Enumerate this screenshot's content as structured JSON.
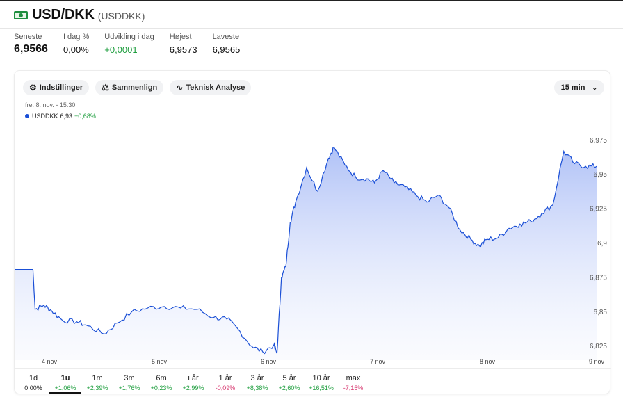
{
  "header": {
    "title": "USD/DKK",
    "subtitle": "(USDDKK)"
  },
  "stats": [
    {
      "label": "Seneste",
      "value": "6,9566"
    },
    {
      "label": "I dag %",
      "value": "0,00%"
    },
    {
      "label": "Udvikling i dag",
      "value": "+0,0001"
    },
    {
      "label": "Højest",
      "value": "6,9573"
    },
    {
      "label": "Laveste",
      "value": "6,9565"
    }
  ],
  "toolbar": {
    "settings": "Indstillinger",
    "compare": "Sammenlign",
    "technical": "Teknisk Analyse",
    "interval": "15 min"
  },
  "datetime": "fre. 8. nov. - 15.30",
  "legend": {
    "name": "USDDKK",
    "value": "6,93",
    "change": "+0,68%"
  },
  "ranges": [
    {
      "label": "1d",
      "change": "0,00%",
      "dir": "neu"
    },
    {
      "label": "1u",
      "change": "+1,06%",
      "dir": "pos",
      "active": true
    },
    {
      "label": "1m",
      "change": "+2,39%",
      "dir": "pos"
    },
    {
      "label": "3m",
      "change": "+1,76%",
      "dir": "pos"
    },
    {
      "label": "6m",
      "change": "+0,23%",
      "dir": "pos"
    },
    {
      "label": "i år",
      "change": "+2,99%",
      "dir": "pos"
    },
    {
      "label": "1 år",
      "change": "-0,09%",
      "dir": "neg"
    },
    {
      "label": "3 år",
      "change": "+8,38%",
      "dir": "pos"
    },
    {
      "label": "5 år",
      "change": "+2,60%",
      "dir": "pos"
    },
    {
      "label": "10 år",
      "change": "+16,51%",
      "dir": "pos"
    },
    {
      "label": "max",
      "change": "-7,15%",
      "dir": "neg"
    }
  ],
  "chart_data": {
    "type": "area",
    "series_name": "USDDKK",
    "x_labels": [
      "4 nov",
      "5 nov",
      "6 nov",
      "7 nov",
      "8 nov",
      "9 nov"
    ],
    "y_ticks": [
      "6,825",
      "6,85",
      "6,875",
      "6,9",
      "6,925",
      "6,95",
      "6,975"
    ],
    "ylim": [
      6.815,
      6.985
    ],
    "line_color": "#1a4fd6",
    "points": [
      [
        3.6,
        6.881
      ],
      [
        3.85,
        6.881
      ],
      [
        3.87,
        6.852
      ],
      [
        3.95,
        6.855
      ],
      [
        4.02,
        6.851
      ],
      [
        4.12,
        6.844
      ],
      [
        4.25,
        6.843
      ],
      [
        4.35,
        6.84
      ],
      [
        4.5,
        6.834
      ],
      [
        4.62,
        6.842
      ],
      [
        4.75,
        6.85
      ],
      [
        4.9,
        6.853
      ],
      [
        5.05,
        6.854
      ],
      [
        5.2,
        6.853
      ],
      [
        5.35,
        6.852
      ],
      [
        5.5,
        6.846
      ],
      [
        5.62,
        6.845
      ],
      [
        5.72,
        6.838
      ],
      [
        5.85,
        6.825
      ],
      [
        5.95,
        6.821
      ],
      [
        6.05,
        6.826
      ],
      [
        6.08,
        6.82
      ],
      [
        6.12,
        6.875
      ],
      [
        6.16,
        6.883
      ],
      [
        6.2,
        6.915
      ],
      [
        6.25,
        6.93
      ],
      [
        6.35,
        6.955
      ],
      [
        6.45,
        6.938
      ],
      [
        6.55,
        6.962
      ],
      [
        6.6,
        6.97
      ],
      [
        6.7,
        6.957
      ],
      [
        6.8,
        6.948
      ],
      [
        6.9,
        6.947
      ],
      [
        6.97,
        6.944
      ],
      [
        7.05,
        6.953
      ],
      [
        7.15,
        6.944
      ],
      [
        7.25,
        6.941
      ],
      [
        7.35,
        6.935
      ],
      [
        7.45,
        6.93
      ],
      [
        7.55,
        6.935
      ],
      [
        7.65,
        6.926
      ],
      [
        7.75,
        6.91
      ],
      [
        7.85,
        6.903
      ],
      [
        7.93,
        6.898
      ],
      [
        8.0,
        6.903
      ],
      [
        8.1,
        6.904
      ],
      [
        8.2,
        6.911
      ],
      [
        8.3,
        6.914
      ],
      [
        8.4,
        6.916
      ],
      [
        8.5,
        6.922
      ],
      [
        8.6,
        6.928
      ],
      [
        8.7,
        6.967
      ],
      [
        8.8,
        6.958
      ],
      [
        8.9,
        6.956
      ],
      [
        9.0,
        6.956
      ]
    ]
  }
}
